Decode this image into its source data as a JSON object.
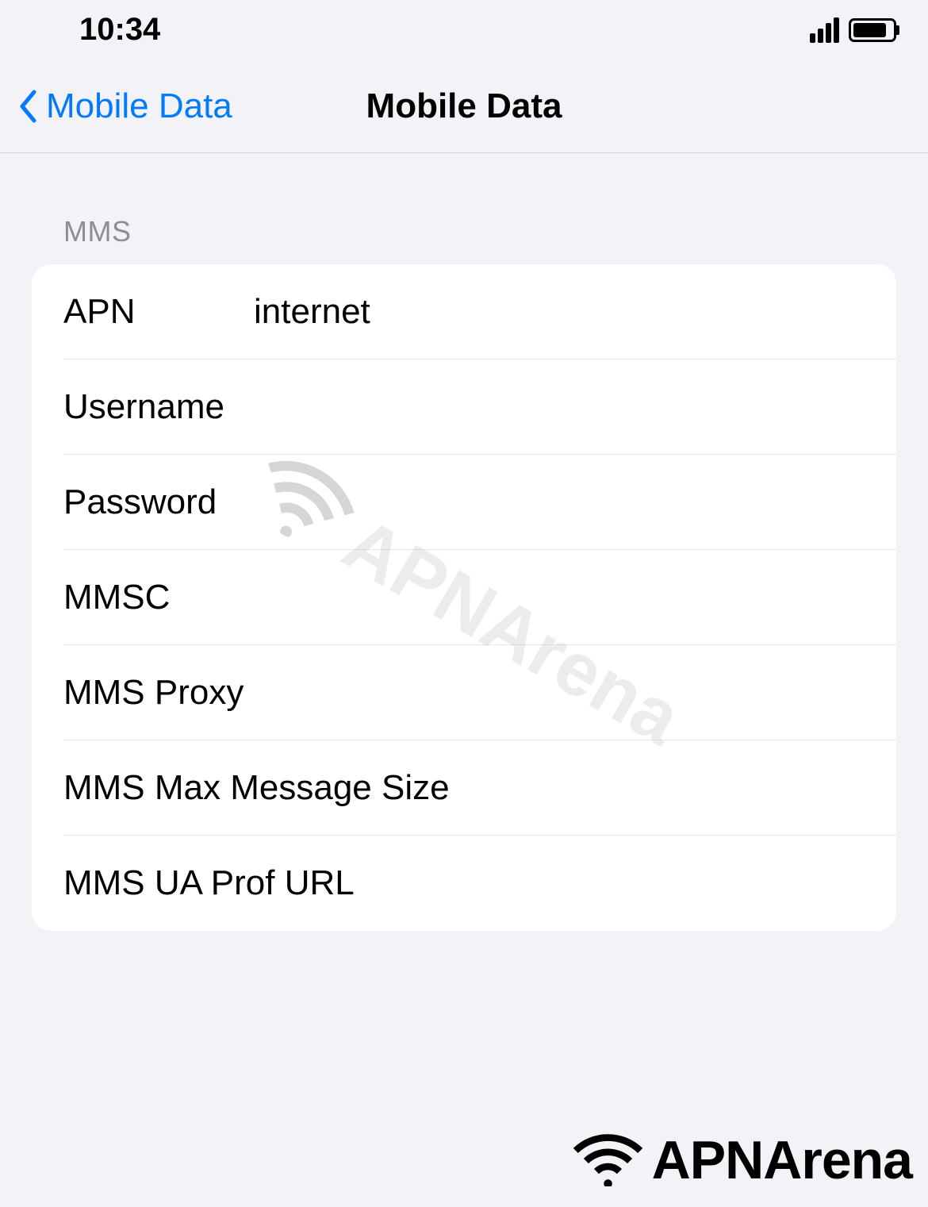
{
  "statusBar": {
    "time": "10:34"
  },
  "nav": {
    "backLabel": "Mobile Data",
    "title": "Mobile Data"
  },
  "section": {
    "header": "MMS",
    "rows": [
      {
        "label": "APN",
        "value": "internet"
      },
      {
        "label": "Username",
        "value": ""
      },
      {
        "label": "Password",
        "value": ""
      },
      {
        "label": "MMSC",
        "value": ""
      },
      {
        "label": "MMS Proxy",
        "value": ""
      },
      {
        "label": "MMS Max Message Size",
        "value": ""
      },
      {
        "label": "MMS UA Prof URL",
        "value": ""
      }
    ]
  },
  "watermark": {
    "text": "APNArena"
  },
  "brand": {
    "text": "APNArena"
  }
}
